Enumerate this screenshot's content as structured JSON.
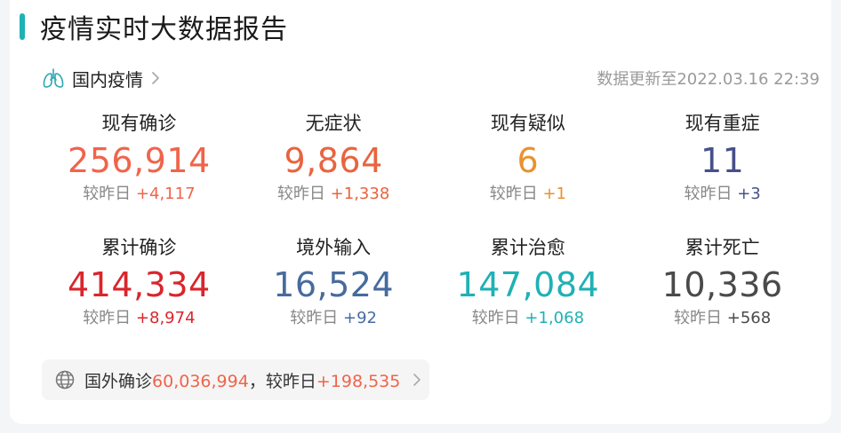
{
  "header": {
    "title": "疫情实时大数据报告"
  },
  "domestic": {
    "label": "国内疫情",
    "updated": "数据更新至2022.03.16 22:39"
  },
  "delta_prefix": "较昨日",
  "stats": [
    {
      "label": "现有确诊",
      "value": "256,914",
      "delta": "+4,117",
      "color": "#f0644b"
    },
    {
      "label": "无症状",
      "value": "9,864",
      "delta": "+1,338",
      "color": "#e8643f"
    },
    {
      "label": "现有疑似",
      "value": "6",
      "delta": "+1",
      "color": "#e8922f"
    },
    {
      "label": "现有重症",
      "value": "11",
      "delta": "+3",
      "color": "#48508a"
    },
    {
      "label": "累计确诊",
      "value": "414,334",
      "delta": "+8,974",
      "color": "#d9262c"
    },
    {
      "label": "境外输入",
      "value": "16,524",
      "delta": "+92",
      "color": "#476b9e"
    },
    {
      "label": "累计治愈",
      "value": "147,084",
      "delta": "+1,068",
      "color": "#1fb1b4"
    },
    {
      "label": "累计死亡",
      "value": "10,336",
      "delta": "+568",
      "color": "#4a4a4a"
    }
  ],
  "foreign": {
    "label": "国外确诊",
    "value": "60,036,994",
    "separator": "，",
    "delta_label": "较昨日",
    "delta": "+198,535",
    "accent": "#f0644b"
  }
}
